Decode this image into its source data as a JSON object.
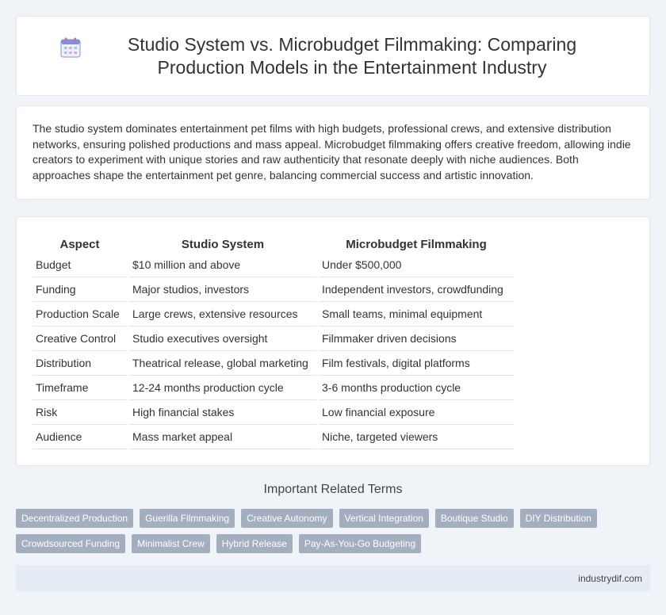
{
  "header": {
    "title": "Studio System vs. Microbudget Filmmaking: Comparing Production Models in the Entertainment Industry",
    "icon": "calendar-icon"
  },
  "intro": {
    "text": "The studio system dominates entertainment pet films with high budgets, professional crews, and extensive distribution networks, ensuring polished productions and mass appeal. Microbudget filmmaking offers creative freedom, allowing indie creators to experiment with unique stories and raw authenticity that resonate deeply with niche audiences. Both approaches shape the entertainment pet genre, balancing commercial success and artistic innovation."
  },
  "table": {
    "headers": [
      "Aspect",
      "Studio System",
      "Microbudget Filmmaking"
    ],
    "rows": [
      [
        "Budget",
        "$10 million and above",
        "Under $500,000"
      ],
      [
        "Funding",
        "Major studios, investors",
        "Independent investors, crowdfunding"
      ],
      [
        "Production Scale",
        "Large crews, extensive resources",
        "Small teams, minimal equipment"
      ],
      [
        "Creative Control",
        "Studio executives oversight",
        "Filmmaker driven decisions"
      ],
      [
        "Distribution",
        "Theatrical release, global marketing",
        "Film festivals, digital platforms"
      ],
      [
        "Timeframe",
        "12-24 months production cycle",
        "3-6 months production cycle"
      ],
      [
        "Risk",
        "High financial stakes",
        "Low financial exposure"
      ],
      [
        "Audience",
        "Mass market appeal",
        "Niche, targeted viewers"
      ]
    ]
  },
  "related": {
    "title": "Important Related Terms",
    "tags": [
      "Decentralized Production",
      "Guerilla Filmmaking",
      "Creative Autonomy",
      "Vertical Integration",
      "Boutique Studio",
      "DIY Distribution",
      "Crowdsourced Funding",
      "Minimalist Crew",
      "Hybrid Release",
      "Pay-As-You-Go Budgeting"
    ]
  },
  "footer": {
    "site": "industrydif.com"
  },
  "colors": {
    "background": "#f0f3f8",
    "tag_bg": "#a3afbf",
    "footer_bg": "#e6ecf6",
    "icon_accent": "#7f8fe8"
  }
}
